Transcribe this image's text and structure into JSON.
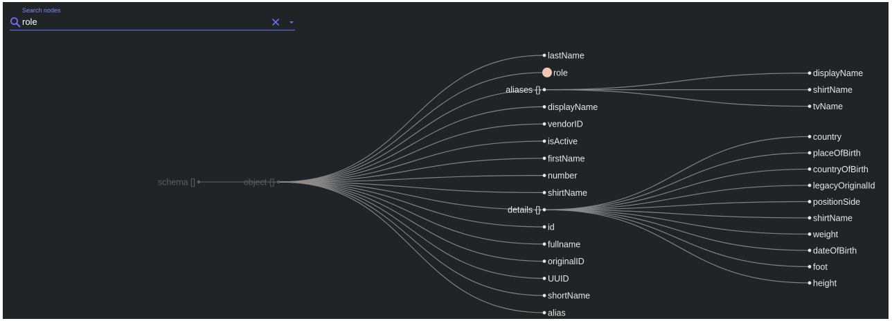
{
  "search": {
    "label": "Search nodes",
    "value": "role",
    "placeholder": "Search nodes"
  },
  "icons": {
    "search": "search-icon",
    "clear": "close-icon",
    "dropdown": "chevron-down-icon"
  },
  "colors": {
    "background": "#212426",
    "accent": "#6a72ff",
    "label_accent": "#7f87ff",
    "link": "#8c8c8c",
    "node_text": "#e6e6e6",
    "dim_text": "#5b5e60",
    "highlight": "#f2c7b6"
  },
  "tree": {
    "root": "schema []",
    "object": "object {}",
    "object_children": [
      {
        "label": "lastName"
      },
      {
        "label": "role",
        "highlight": true
      },
      {
        "label": "aliases {}",
        "children": [
          "displayName",
          "shirtName",
          "tvName"
        ]
      },
      {
        "label": "displayName"
      },
      {
        "label": "vendorID"
      },
      {
        "label": "isActive"
      },
      {
        "label": "firstName"
      },
      {
        "label": "number"
      },
      {
        "label": "shirtName"
      },
      {
        "label": "details {}",
        "children": [
          "country",
          "placeOfBirth",
          "countryOfBirth",
          "legacyOriginalId",
          "positionSide",
          "shirtName",
          "weight",
          "dateOfBirth",
          "foot",
          "height"
        ]
      },
      {
        "label": "id"
      },
      {
        "label": "fullname"
      },
      {
        "label": "originalID"
      },
      {
        "label": "UUID"
      },
      {
        "label": "shortName"
      },
      {
        "label": "alias"
      }
    ]
  }
}
